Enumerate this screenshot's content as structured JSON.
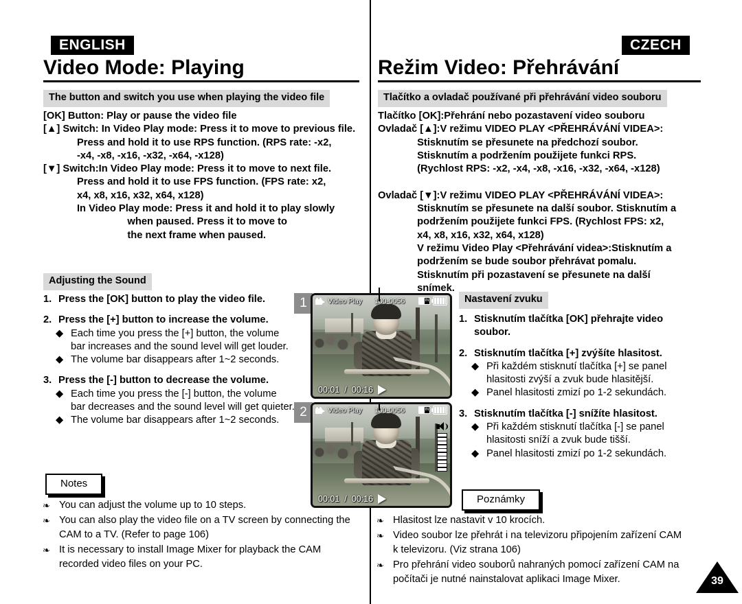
{
  "left": {
    "language_badge": "ENGLISH",
    "title": "Video Mode: Playing",
    "section1_heading": "The button and switch you use when playing the video file",
    "spec_text": "[OK] Button: Play or pause the video file\n[▲] Switch: In Video Play mode: Press it to move to previous file.\n            Press and hold it to use RPS function. (RPS rate: -x2,\n            -x4, -x8, -x16, -x32, -x64, -x128)\n[▼] Switch:In Video Play mode: Press it to move to next file.\n            Press and hold it to use FPS function. (FPS rate: x2,\n            x4, x8, x16, x32, x64, x128)\n            In Video Play mode: Press it and hold it to play slowly\n                              when paused. Press it to move to\n                              the next frame when paused.",
    "section2_heading": "Adjusting the Sound",
    "steps": [
      {
        "number": "1.",
        "text": "Press the [OK] button to play the video file.",
        "bullets": []
      },
      {
        "number": "2.",
        "text": "Press the [+] button to increase the volume.",
        "bullets": [
          "Each time you press the [+] button, the volume\nbar increases and the sound level will get louder.",
          "The volume bar disappears after 1~2 seconds."
        ]
      },
      {
        "number": "3.",
        "text": "Press the [-] button to decrease the volume.",
        "bullets": [
          "Each time you press the [-] button, the volume\nbar decreases and the sound level will get quieter.",
          "The volume bar disappears after 1~2 seconds."
        ]
      }
    ],
    "notes_label": "Notes",
    "notes": [
      "You can adjust the volume up to 10 steps.",
      "You can also play the video file on a TV screen by connecting the\nCAM to a TV. (Refer to page 106)",
      "It is necessary to install Image Mixer for playback the CAM\nrecorded video files on your PC."
    ]
  },
  "right": {
    "language_badge": "CZECH",
    "title": "Režim Video: Přehrávání",
    "section1_heading": "Tlačítko a ovladač používané při přehrávání video souboru",
    "spec_text": "Tlačítko [OK]:Přehrání nebo pozastavení video souboru\nOvladač [▲]:V režimu VIDEO PLAY <PŘEHRÁVÁNÍ VIDEA>:\n              Stisknutím se přesunete na předchozí soubor.\n              Stisknutím a podržením použijete funkci RPS.\n              (Rychlost RPS: -x2, -x4, -x8, -x16, -x32, -x64, -x128)\n\nOvladač [▼]:V režimu VIDEO PLAY <PŘEHRÁVÁNÍ VIDEA>:\n              Stisknutím se přesunete na další soubor. Stisknutím a\n              podržením použijete funkci FPS. (Rychlost FPS: x2,\n              x4, x8, x16, x32, x64, x128)\n              V režimu Video Play <Přehrávání videa>:Stisknutím a\n              podržením se bude soubor přehrávat pomalu.\n              Stisknutím při pozastavení se přesunete na další\n              snímek.",
    "section2_heading": "Nastavení zvuku",
    "steps": [
      {
        "number": "1.",
        "text": "Stisknutím tlačítka [OK] přehrajte video\nsoubor.",
        "bullets": []
      },
      {
        "number": "2.",
        "text": "Stisknutím tlačítka [+] zvýšíte hlasitost.",
        "bullets": [
          "Při každém stisknutí tlačítka [+] se panel\nhlasitosti zvýší a zvuk bude hlasitější.",
          "Panel hlasitosti zmizí po 1-2 sekundách."
        ]
      },
      {
        "number": "3.",
        "text": "Stisknutím tlačítka [-] snížíte hlasitost.",
        "bullets": [
          "Při každém stisknutí tlačítka [-] se panel\nhlasitosti sníží a zvuk bude tišší.",
          "Panel hlasitosti zmizí po 1-2 sekundách."
        ]
      }
    ],
    "notes_label": "Poznámky",
    "notes": [
      "Hlasitost lze nastavit v 10 krocích.",
      "Video soubor lze přehrát i na televizoru připojením zařízení CAM\nk televizoru. (Viz strana 106)",
      "Pro přehrání video souborů nahraných pomocí zařízení CAM na\npočítači je nutné nainstalovat aplikaci Image Mixer."
    ]
  },
  "screens": [
    {
      "step_chip": "1",
      "osd_mode": "Video Play",
      "osd_file": "100-0056",
      "time_current": "00:01",
      "time_separator": "/",
      "time_total": "00:16",
      "memory_label": "IN",
      "volume_visible": false,
      "volume_level": 0
    },
    {
      "step_chip": "2",
      "osd_mode": "Video Play",
      "osd_file": "100-0056",
      "time_current": "00:01",
      "time_separator": "/",
      "time_total": "00:16",
      "memory_label": "IN",
      "volume_visible": true,
      "volume_level": 10
    }
  ],
  "page_number": "39",
  "colors": {
    "band_background": "#d9d9d9",
    "badge_background": "#000000",
    "step_chip_background": "#8c8c8c"
  }
}
